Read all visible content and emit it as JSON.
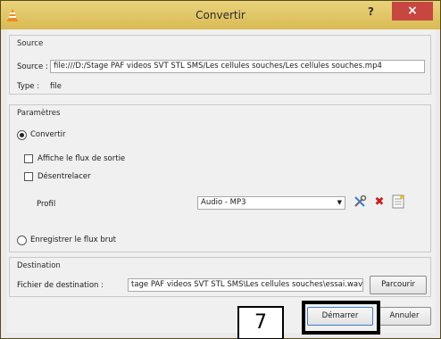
{
  "window": {
    "title": "Convertir",
    "help_label": "?",
    "close_label": "×",
    "icon": "vlc-cone-icon"
  },
  "source": {
    "group_title": "Source",
    "source_label": "Source :",
    "source_value": "file:///D:/Stage PAF videos SVT STL SMS/Les cellules souches/Les cellules souches.mp4",
    "type_label": "Type :",
    "type_value": "file"
  },
  "parametres": {
    "group_title": "Paramètres",
    "convertir_label": "Convertir",
    "convertir_checked": true,
    "affiche_label": "Affiche le flux de sortie",
    "affiche_checked": false,
    "desentrelacer_label": "Désentrelacer",
    "desentrelacer_checked": false,
    "profil_label": "Profil",
    "profil_value": "Audio - MP3",
    "tool_icons": [
      "wrench-screwdriver-icon",
      "delete-x-icon",
      "new-profile-icon"
    ],
    "enregistrer_label": "Enregistrer le flux brut",
    "enregistrer_checked": false
  },
  "destination": {
    "group_title": "Destination",
    "fichier_label": "Fichier de destination :",
    "fichier_value": "tage PAF videos SVT STL SMS\\Les cellules souches\\essai.wav",
    "parcourir_label": "Parcourir"
  },
  "buttons": {
    "demarrer_label": "Démarrer",
    "annuler_label": "Annuler"
  },
  "annotation": {
    "step_number": "7"
  },
  "colors": {
    "titlebar": "#dcc15c",
    "close_button": "#c74740",
    "delete_icon": "#cc1f1f"
  }
}
